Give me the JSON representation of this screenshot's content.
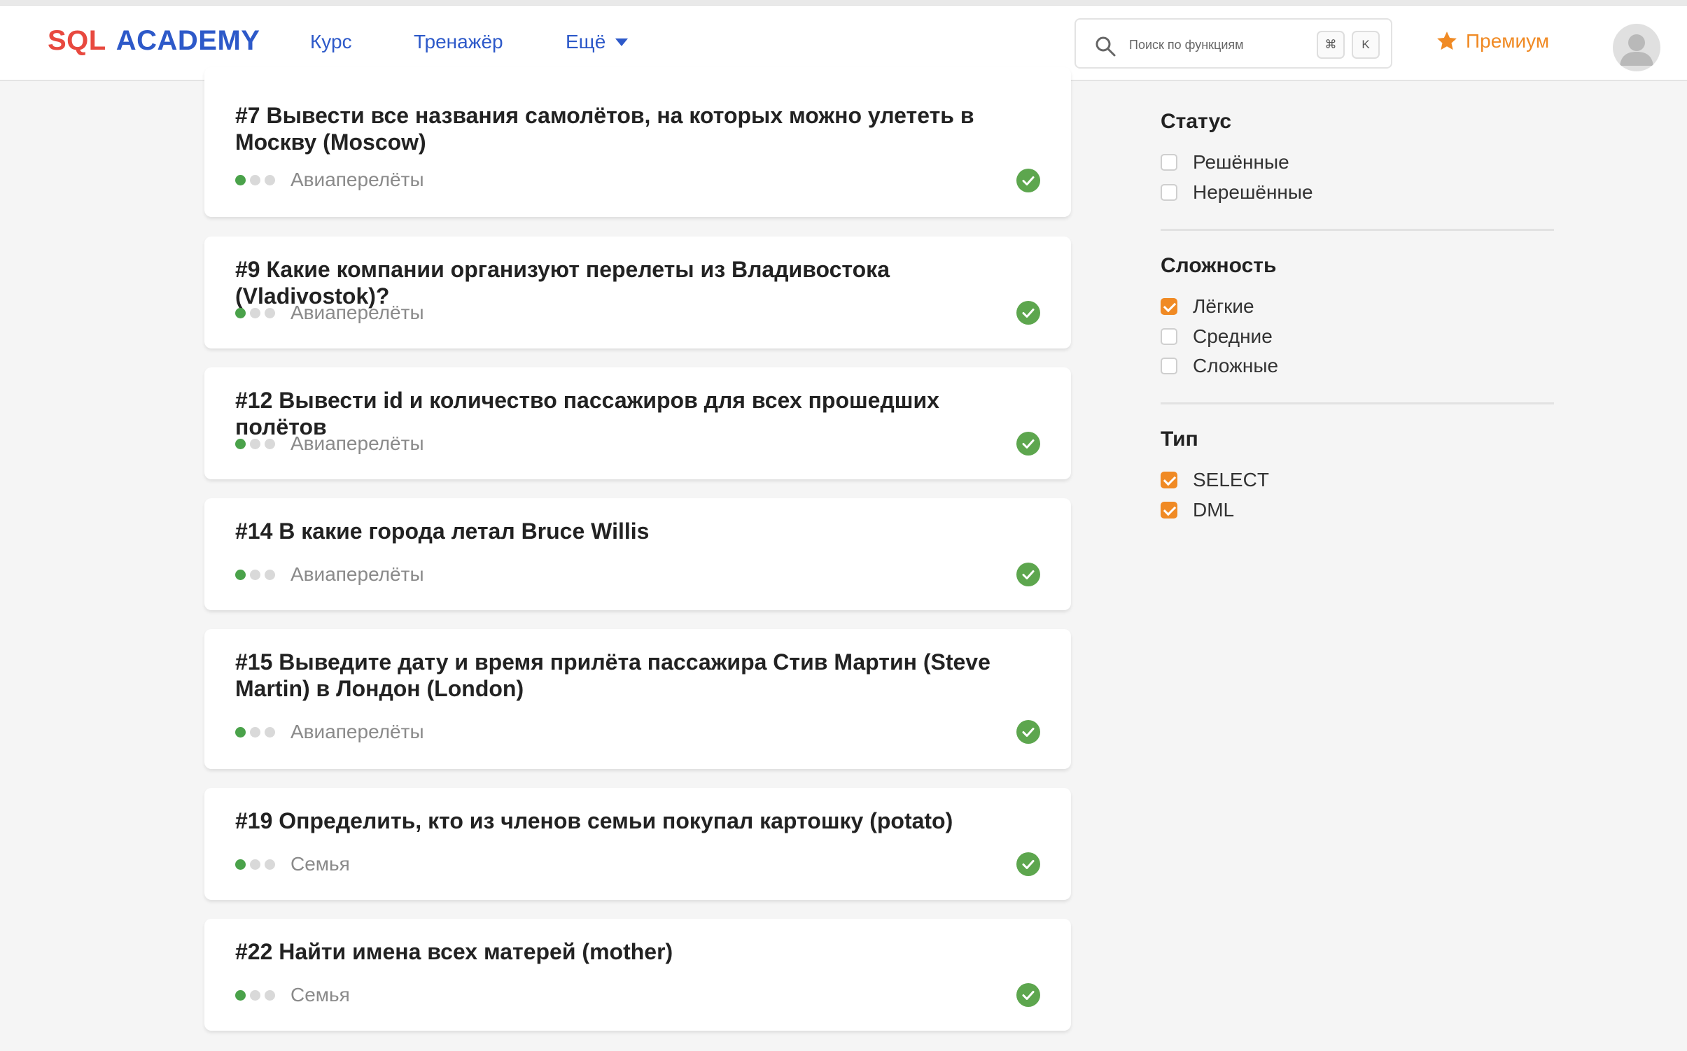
{
  "header": {
    "logo_sql": "SQL",
    "logo_academy": "ACADEMY",
    "nav": [
      {
        "label": "Курс"
      },
      {
        "label": "Тренажёр"
      },
      {
        "label": "Ещё"
      }
    ],
    "search_placeholder": "Поиск по функциям",
    "shortcut_keys": [
      "⌘",
      "K"
    ],
    "premium_label": "Премиум"
  },
  "tasks": [
    {
      "title": "#7 Вывести все названия самолётов, на которых можно улететь в Москву (Moscow)",
      "category": "Авиаперелёты",
      "difficulty": 1,
      "solved": true
    },
    {
      "title": "#9 Какие компании организуют перелеты из Владивостока (Vladivostok)?",
      "category": "Авиаперелёты",
      "difficulty": 1,
      "solved": true
    },
    {
      "title": "#12 Вывести id и количество пассажиров для всех прошедших полётов",
      "category": "Авиаперелёты",
      "difficulty": 1,
      "solved": true
    },
    {
      "title": "#14 В какие города летал Bruce Willis",
      "category": "Авиаперелёты",
      "difficulty": 1,
      "solved": true
    },
    {
      "title": "#15 Выведите дату и время прилёта пассажира Стив Мартин (Steve Martin) в Лондон (London)",
      "category": "Авиаперелёты",
      "difficulty": 1,
      "solved": true
    },
    {
      "title": "#19 Определить, кто из членов семьи покупал картошку (potato)",
      "category": "Семья",
      "difficulty": 1,
      "solved": true
    },
    {
      "title": "#22 Найти имена всех матерей (mother)",
      "category": "Семья",
      "difficulty": 1,
      "solved": true
    }
  ],
  "filters": {
    "status": {
      "title": "Статус",
      "options": [
        {
          "label": "Решённые",
          "checked": false
        },
        {
          "label": "Нерешённые",
          "checked": false
        }
      ]
    },
    "difficulty": {
      "title": "Сложность",
      "options": [
        {
          "label": "Лёгкие",
          "checked": true
        },
        {
          "label": "Средние",
          "checked": false
        },
        {
          "label": "Сложные",
          "checked": false
        }
      ]
    },
    "type": {
      "title": "Тип",
      "options": [
        {
          "label": "SELECT",
          "checked": true
        },
        {
          "label": "DML",
          "checked": true
        }
      ]
    }
  },
  "colors": {
    "brand_red": "#e8493f",
    "brand_blue": "#2d59c9",
    "accent_orange": "#f08a24",
    "success_green": "#4aa24a"
  }
}
